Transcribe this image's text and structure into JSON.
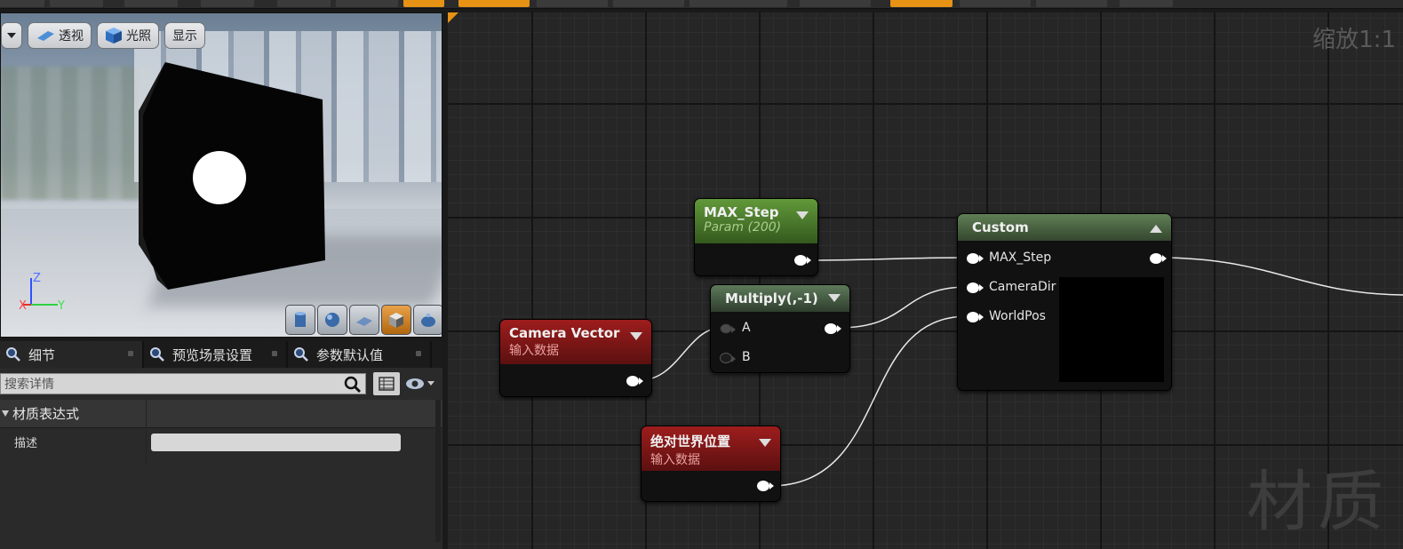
{
  "viewport": {
    "toolbar": {
      "perspective_label": "透视",
      "lighting_label": "光照",
      "show_label": "显示"
    },
    "axes": {
      "z": "Z",
      "x": "X",
      "y": "Y"
    }
  },
  "details": {
    "tabs": [
      {
        "label": "细节"
      },
      {
        "label": "预览场景设置"
      },
      {
        "label": "参数默认值"
      }
    ],
    "search": {
      "placeholder": "搜索详情"
    },
    "category": "材质表达式",
    "properties": [
      {
        "name": "描述",
        "value": ""
      }
    ]
  },
  "graph": {
    "zoom": "缩放1:1",
    "watermark": "材质",
    "nodes": {
      "max_step": {
        "title": "MAX_Step",
        "subtitle": "Param (200)"
      },
      "camera_vector": {
        "title": "Camera Vector",
        "subtitle": "输入数据"
      },
      "multiply": {
        "title": "Multiply(,-1)",
        "inputs": [
          "A",
          "B"
        ]
      },
      "world_pos": {
        "title": "绝对世界位置",
        "subtitle": "输入数据"
      },
      "custom": {
        "title": "Custom",
        "inputs": [
          "MAX_Step",
          "CameraDir",
          "WorldPos"
        ]
      }
    }
  },
  "colors": {
    "accent": "#e59215",
    "input_node_header": "#9e1d1d",
    "param_node_header": "#62993a",
    "graph_background": "#262626"
  }
}
